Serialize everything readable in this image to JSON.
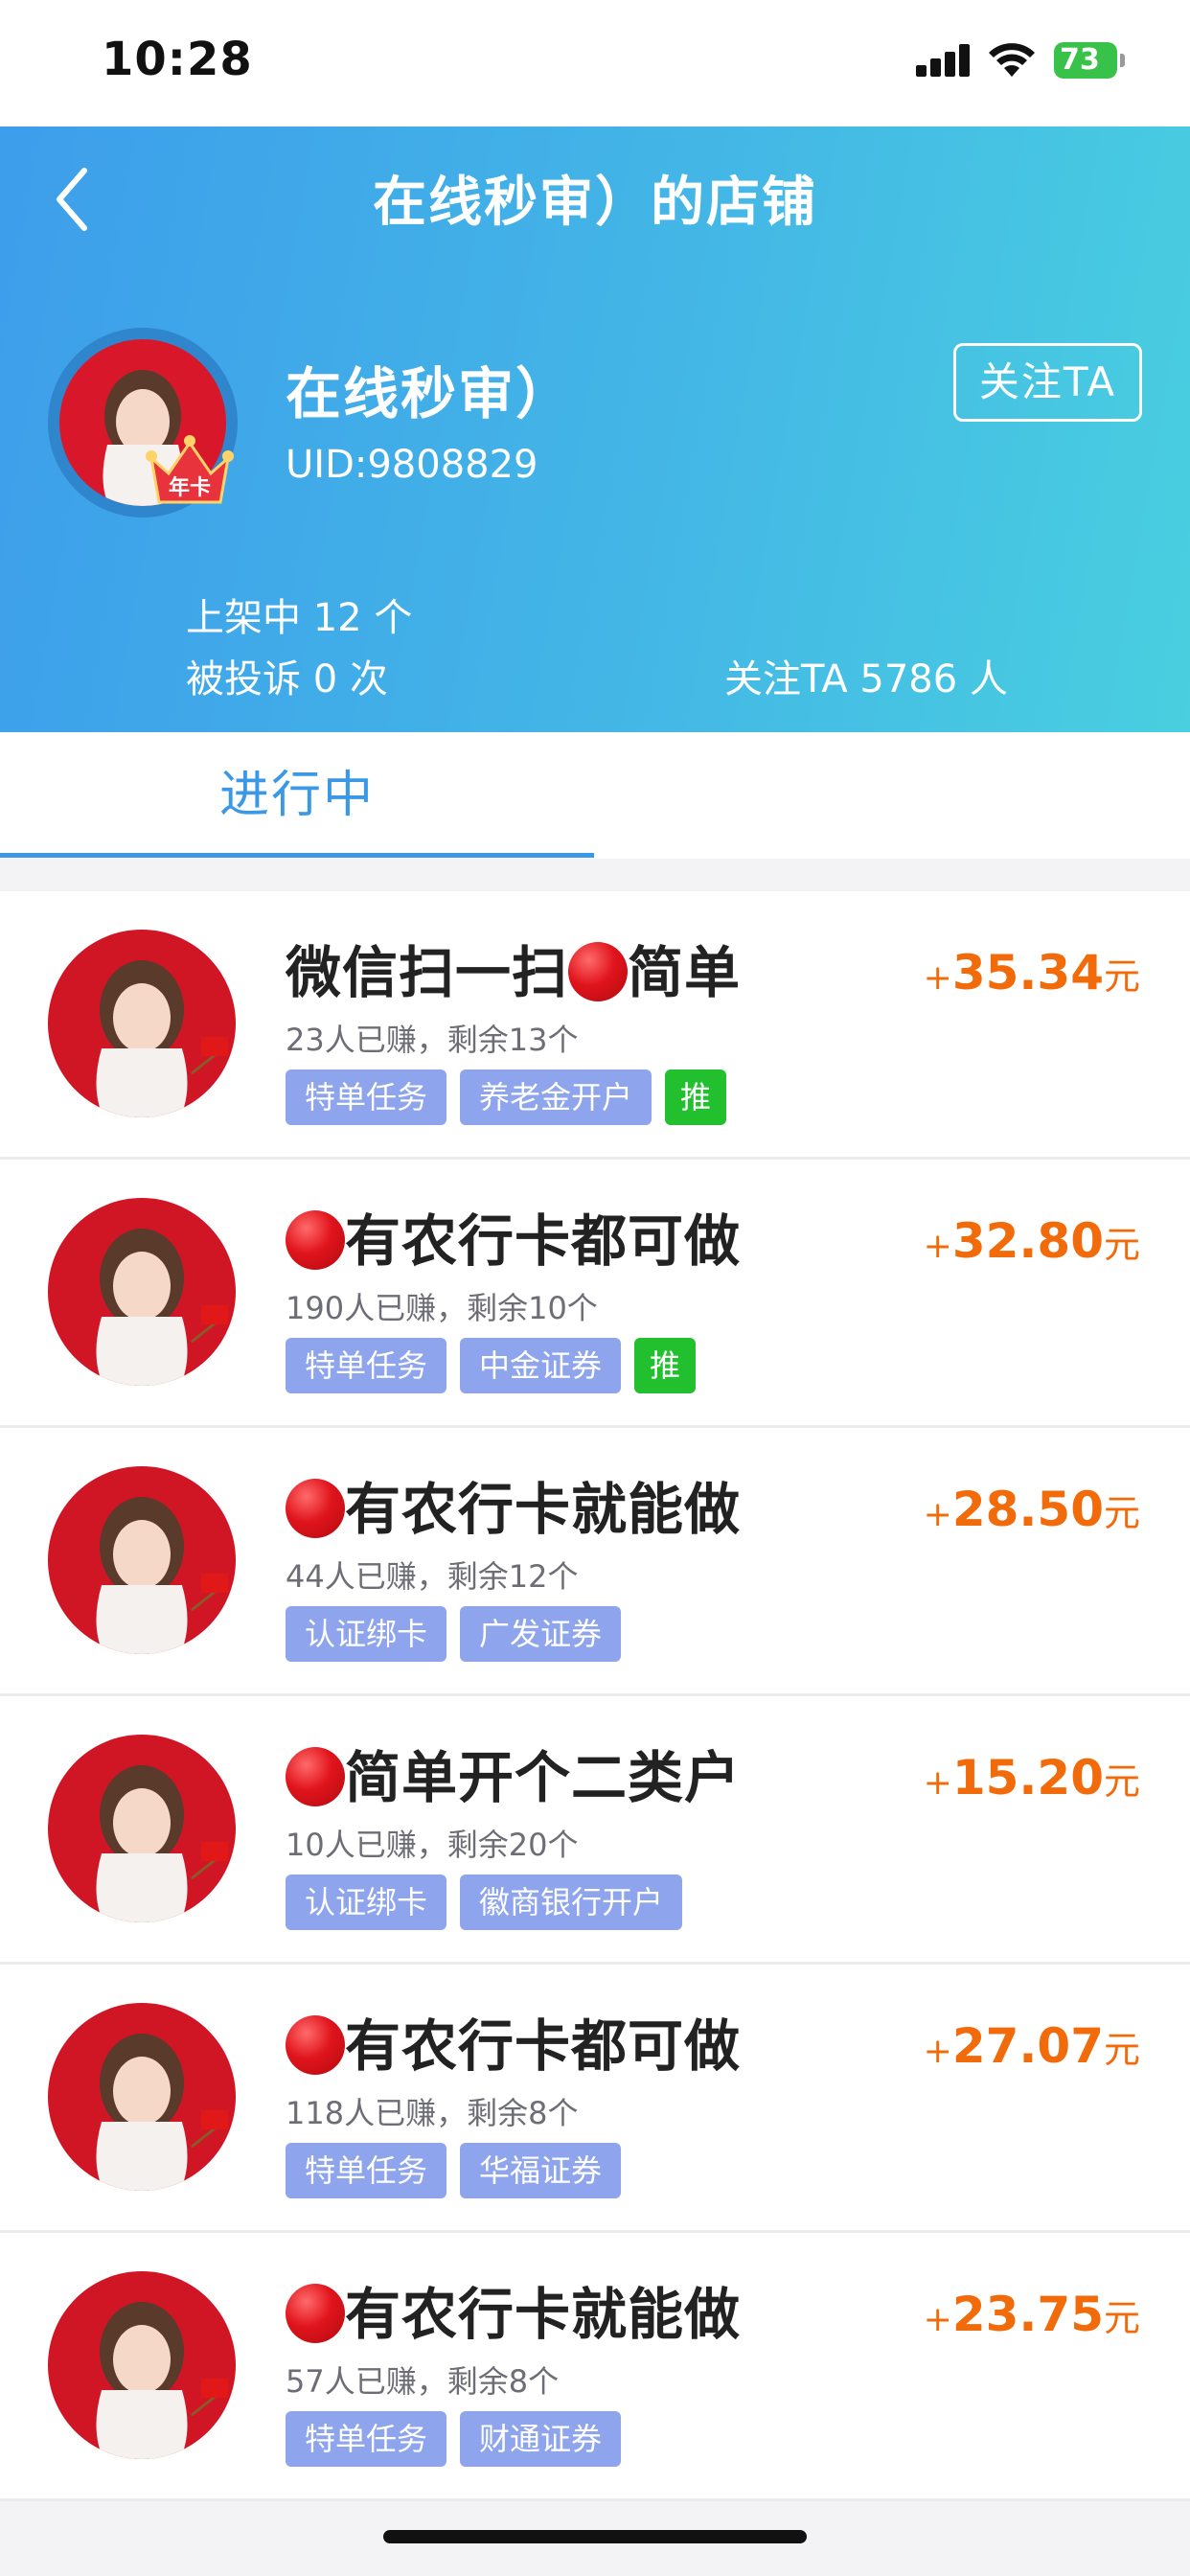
{
  "status_bar": {
    "time": "10:28",
    "battery": "73"
  },
  "header": {
    "title": "在线秒审）的店铺",
    "profile": {
      "name": "在线秒审）",
      "uid": "UID:9808829",
      "badge": "年卡"
    },
    "follow_button": "关注TA",
    "stats": {
      "listed": "上架中 12 个",
      "complaints": "被投诉 0 次",
      "followers": "关注TA 5786 人"
    }
  },
  "tabs": {
    "active": "进行中"
  },
  "tasks": [
    {
      "title": "微信扫一扫",
      "title_suffix": "简单",
      "dot": "middle",
      "stats": "23人已赚，剩余13个",
      "tags": [
        "特单任务",
        "养老金开户"
      ],
      "push": "推",
      "reward": {
        "plus": "+",
        "amount": "35.34",
        "unit": "元"
      }
    },
    {
      "title": "有农行卡都可做",
      "dot": "start",
      "stats": "190人已赚，剩余10个",
      "tags": [
        "特单任务",
        "中金证券"
      ],
      "push": "推",
      "reward": {
        "plus": "+",
        "amount": "32.80",
        "unit": "元"
      }
    },
    {
      "title": "有农行卡就能做",
      "dot": "start",
      "stats": "44人已赚，剩余12个",
      "tags": [
        "认证绑卡",
        "广发证券"
      ],
      "reward": {
        "plus": "+",
        "amount": "28.50",
        "unit": "元"
      }
    },
    {
      "title": "简单开个二类户",
      "dot": "start",
      "stats": "10人已赚，剩余20个",
      "tags": [
        "认证绑卡",
        "徽商银行开户"
      ],
      "reward": {
        "plus": "+",
        "amount": "15.20",
        "unit": "元"
      }
    },
    {
      "title": "有农行卡都可做",
      "dot": "start",
      "stats": "118人已赚，剩余8个",
      "tags": [
        "特单任务",
        "华福证券"
      ],
      "reward": {
        "plus": "+",
        "amount": "27.07",
        "unit": "元"
      }
    },
    {
      "title": "有农行卡就能做",
      "dot": "start",
      "stats": "57人已赚，剩余8个",
      "tags": [
        "特单任务",
        "财通证券"
      ],
      "reward": {
        "plus": "+",
        "amount": "23.75",
        "unit": "元"
      }
    }
  ],
  "colors": {
    "accent": "#3a98e6",
    "reward": "#f26b0a",
    "tag": "#8ea4ec",
    "push_tag": "#22c02e",
    "avatar_bg": "#d01525"
  }
}
